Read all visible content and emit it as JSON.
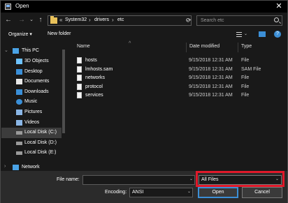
{
  "window": {
    "title": "Open",
    "close_glyph": "✕"
  },
  "nav": {
    "back_glyph": "←",
    "forward_glyph": "→",
    "recent_glyph": "⌄",
    "up_glyph": "↑",
    "overflow": "«",
    "breadcrumbs": [
      "System32",
      "drivers",
      "etc"
    ],
    "separator": "›",
    "refresh_glyph": "⟳",
    "search_placeholder": "Search etc"
  },
  "toolbar": {
    "organize_label": "Organize ▾",
    "new_folder_label": "New folder",
    "help_glyph": "?"
  },
  "sidebar": {
    "items": [
      {
        "label": "This PC",
        "icon": "computer-icon",
        "level": 0
      },
      {
        "label": "3D Objects",
        "icon": "3d-objects-icon",
        "level": 1
      },
      {
        "label": "Desktop",
        "icon": "desktop-icon",
        "level": 1
      },
      {
        "label": "Documents",
        "icon": "documents-icon",
        "level": 1
      },
      {
        "label": "Downloads",
        "icon": "downloads-icon",
        "level": 1
      },
      {
        "label": "Music",
        "icon": "music-icon",
        "level": 1
      },
      {
        "label": "Pictures",
        "icon": "pictures-icon",
        "level": 1
      },
      {
        "label": "Videos",
        "icon": "videos-icon",
        "level": 1
      },
      {
        "label": "Local Disk (C:)",
        "icon": "disk-icon",
        "level": 1,
        "selected": true
      },
      {
        "label": "Local Disk (D:)",
        "icon": "disk-icon",
        "level": 1
      },
      {
        "label": "Local Disk (E:)",
        "icon": "disk-icon",
        "level": 1
      },
      {
        "label": "Network",
        "icon": "network-icon",
        "level": 0
      }
    ]
  },
  "files": {
    "columns": {
      "name": "Name",
      "date": "Date modified",
      "type": "Type"
    },
    "rows": [
      {
        "name": "hosts",
        "date": "9/15/2018 12:31 AM",
        "type": "File"
      },
      {
        "name": "lmhosts.sam",
        "date": "9/15/2018 12:31 AM",
        "type": "SAM File"
      },
      {
        "name": "networks",
        "date": "9/15/2018 12:31 AM",
        "type": "File"
      },
      {
        "name": "protocol",
        "date": "9/15/2018 12:31 AM",
        "type": "File"
      },
      {
        "name": "services",
        "date": "9/15/2018 12:31 AM",
        "type": "File"
      }
    ]
  },
  "footer": {
    "file_name_label": "File name:",
    "file_name_value": "",
    "file_type_value": "All Files",
    "encoding_label": "Encoding:",
    "encoding_value": "ANSI",
    "open_label": "Open",
    "cancel_label": "Cancel",
    "dropdown_glyph": "⌄"
  },
  "colors": {
    "background": "#191919",
    "footer_background": "#2b2b2b",
    "highlight_border": "#e0192a",
    "accent": "#3c8fd6"
  }
}
